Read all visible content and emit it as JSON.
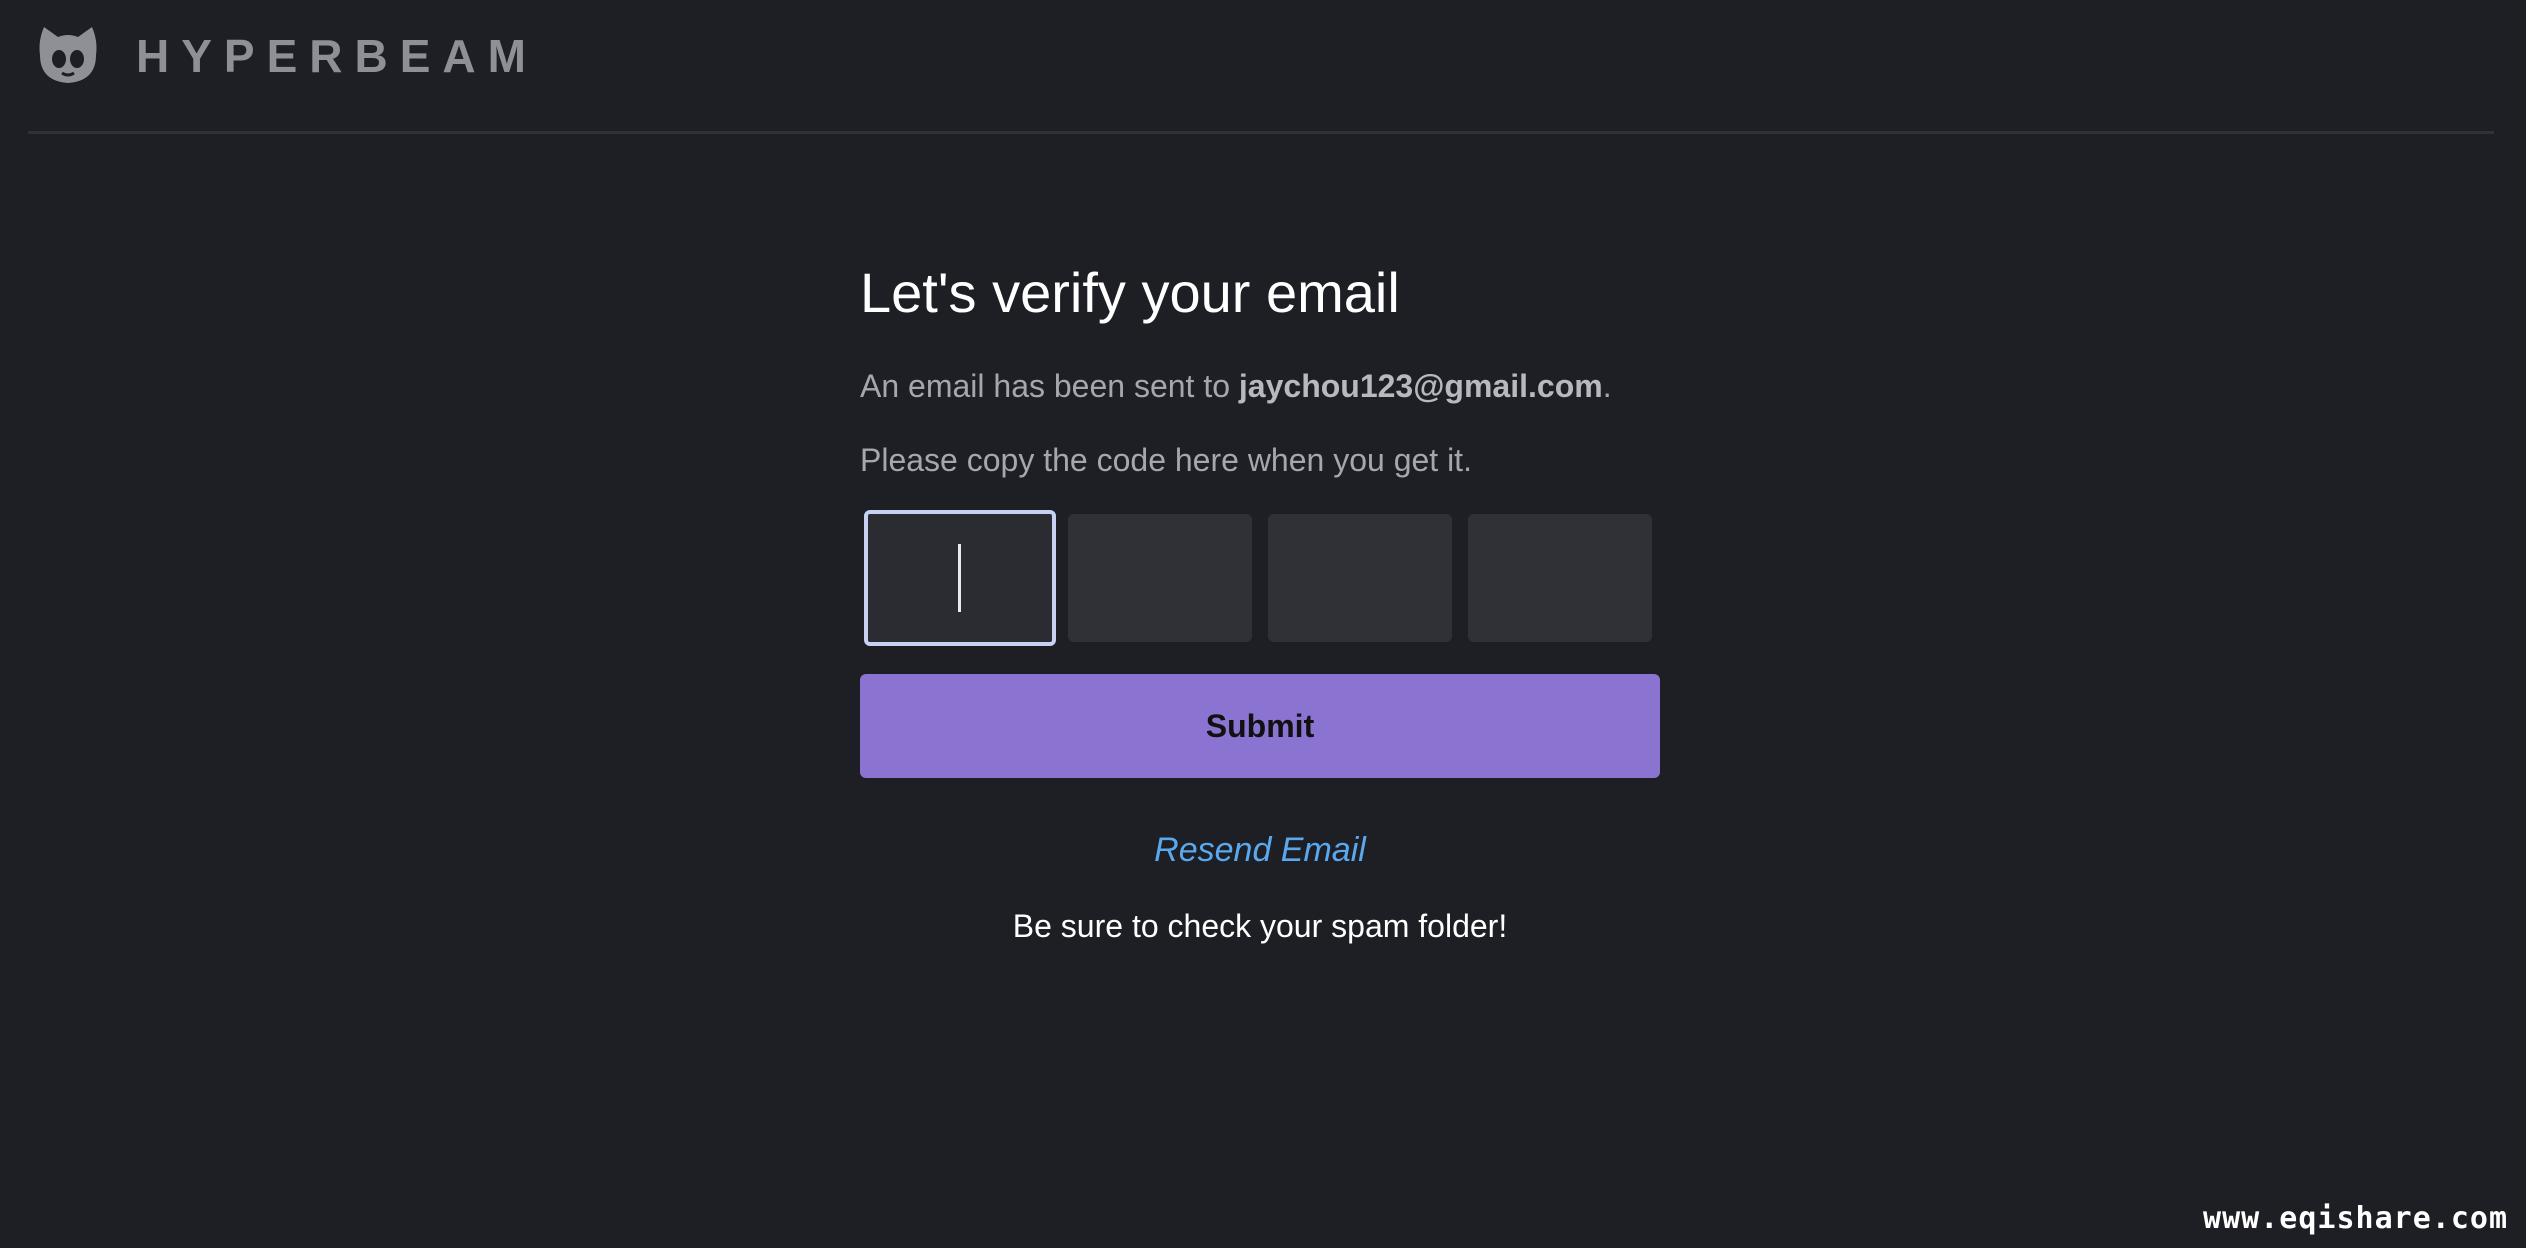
{
  "header": {
    "logo_icon": "cat-face-icon",
    "brand": "HYPERBEAM"
  },
  "verify": {
    "title": "Let's verify your email",
    "sent_prefix": "An email has been sent to ",
    "email": "jaychou123@gmail.com",
    "sent_suffix": ".",
    "instruction": "Please copy the code here when you get it.",
    "code_values": [
      "",
      "",
      "",
      ""
    ],
    "submit_label": "Submit",
    "resend_label": "Resend Email",
    "spam_note": "Be sure to check your spam folder!"
  },
  "watermark": "www.eqishare.com",
  "colors": {
    "background": "#1e1f25",
    "accent_button": "#8b73d2",
    "link": "#5aa8ee",
    "focus_border": "#c7d2f2"
  }
}
